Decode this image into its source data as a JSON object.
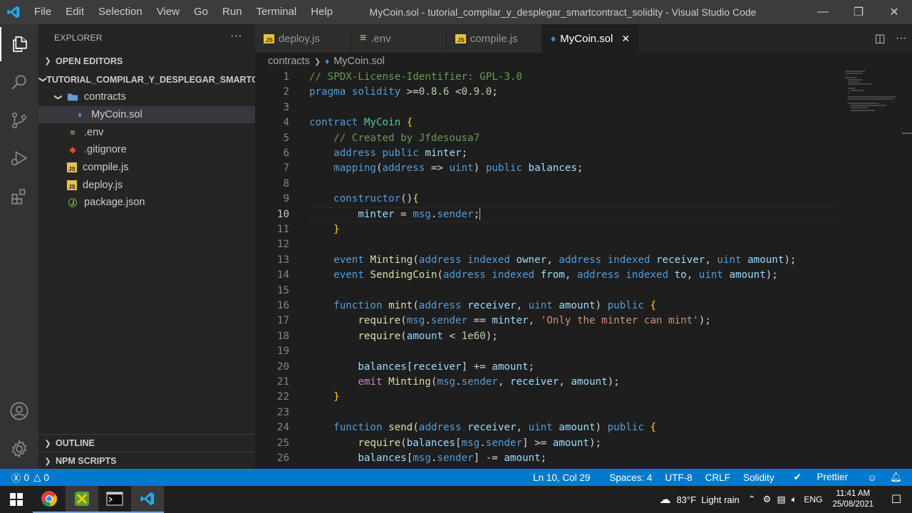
{
  "titlebar": {
    "menu": [
      "File",
      "Edit",
      "Selection",
      "View",
      "Go",
      "Run",
      "Terminal",
      "Help"
    ],
    "title": "MyCoin.sol - tutorial_compilar_y_desplegar_smartcontract_solidity - Visual Studio Code"
  },
  "sidebar": {
    "title": "EXPLORER",
    "open_editors": "OPEN EDITORS",
    "workspace": "TUTORIAL_COMPILAR_Y_DESPLEGAR_SMARTC...",
    "folder": "contracts",
    "files": [
      {
        "name": "MyCoin.sol",
        "icon": "solidity-icon"
      },
      {
        "name": ".env",
        "icon": "env-icon"
      },
      {
        "name": ".gitignore",
        "icon": "git-icon"
      },
      {
        "name": "compile.js",
        "icon": "js-icon"
      },
      {
        "name": "deploy.js",
        "icon": "js-icon"
      },
      {
        "name": "package.json",
        "icon": "npm-icon"
      }
    ],
    "outline": "OUTLINE",
    "npm_scripts": "NPM SCRIPTS"
  },
  "tabs": [
    {
      "label": "deploy.js",
      "icon": "JS"
    },
    {
      "label": ".env",
      "icon": "env"
    },
    {
      "label": "compile.js",
      "icon": "JS"
    },
    {
      "label": "MyCoin.sol",
      "icon": "sol",
      "active": true
    }
  ],
  "breadcrumb": {
    "folder": "contracts",
    "file": "MyCoin.sol"
  },
  "editor": {
    "current_line": 10,
    "lines": [
      "// SPDX-License-Identifier: GPL-3.0",
      "pragma solidity >=0.8.6 <0.9.0;",
      "",
      "contract MyCoin {",
      "    // Created by Jfdesousa7",
      "    address public minter;",
      "    mapping(address => uint) public balances;",
      "",
      "    constructor(){",
      "        minter = msg.sender;",
      "    }",
      "",
      "    event Minting(address indexed owner, address indexed receiver, uint amount);",
      "    event SendingCoin(address indexed from, address indexed to, uint amount);",
      "",
      "    function mint(address receiver, uint amount) public {",
      "        require(msg.sender == minter, 'Only the minter can mint');",
      "        require(amount < 1e60);",
      "",
      "        balances[receiver] += amount;",
      "        emit Minting(msg.sender, receiver, amount);",
      "    }",
      "",
      "    function send(address receiver, uint amount) public {",
      "        require(balances[msg.sender] >= amount);",
      "        balances[msg.sender] -= amount;"
    ]
  },
  "statusbar": {
    "errors": "0",
    "warnings": "0",
    "position": "Ln 10, Col 29",
    "spaces": "Spaces: 4",
    "encoding": "UTF-8",
    "eol": "CRLF",
    "language": "Solidity",
    "formatter": "Prettier"
  },
  "taskbar": {
    "weather": "83°F  Light rain",
    "lang": "ENG",
    "time": "11:41 AM",
    "date": "25/08/2021"
  }
}
